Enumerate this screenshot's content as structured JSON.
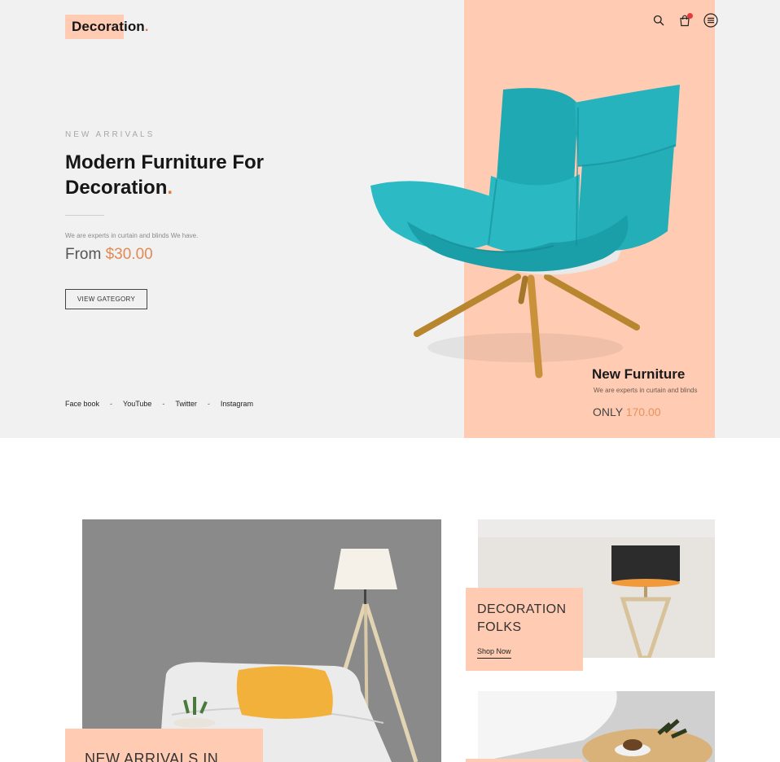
{
  "brand": {
    "name": "Decoration",
    "dot": "."
  },
  "header": {
    "icons": [
      "search-icon",
      "cart-icon",
      "menu-icon"
    ]
  },
  "hero": {
    "eyebrow": "NEW ARRIVALS",
    "headline_line1": "Modern Furniture For",
    "headline_line2": "Decoration",
    "headline_dot": ".",
    "subtitle": "We are experts in curtain and blinds We have.",
    "price_prefix": "From",
    "price_value": "$30.00",
    "cta_label": "VIEW GATEGORY",
    "social": [
      "Face book",
      "YouTube",
      "Twitter",
      "Instagram"
    ],
    "social_separator": "-"
  },
  "featured": {
    "title": "New Furniture",
    "subtitle": "We are experts in curtain and blinds",
    "price_prefix": "ONLY",
    "price_value": "170.00"
  },
  "categories": {
    "big_label": "NEW ARRIVALS IN",
    "card1_title": "DECORATION FOLKS",
    "card1_link": "Shop Now"
  },
  "colors": {
    "accent_peach": "#ffcbb3",
    "accent_orange": "#e07d46",
    "chair_teal": "#2bb4bd",
    "hero_bg": "#f1f1f1"
  }
}
